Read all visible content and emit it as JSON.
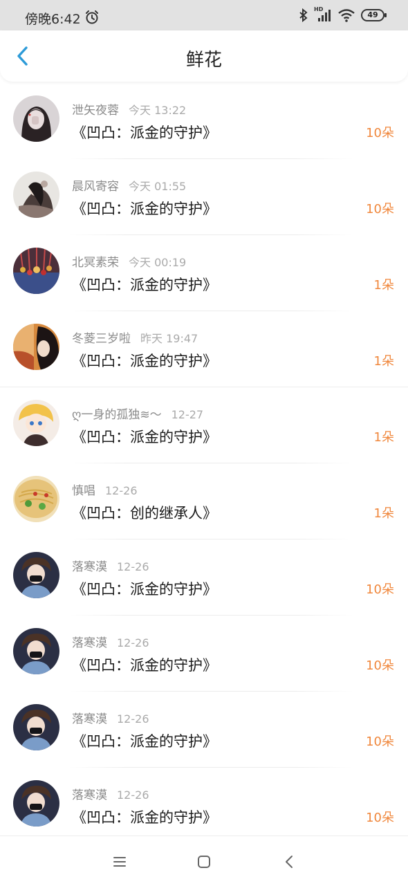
{
  "status": {
    "time": "傍晚6:42",
    "battery": "49",
    "hd": "HD"
  },
  "header": {
    "title": "鲜花"
  },
  "rows": [
    {
      "name": "泄矢夜蓉",
      "time": "今天 13:22",
      "book": "《凹凸：派金的守护》",
      "count": "10朵"
    },
    {
      "name": "晨风寄容",
      "time": "今天 01:55",
      "book": "《凹凸：派金的守护》",
      "count": "10朵"
    },
    {
      "name": "北冥素荣",
      "time": "今天 00:19",
      "book": "《凹凸：派金的守护》",
      "count": "1朵"
    },
    {
      "name": "冬菱三岁啦",
      "time": "昨天 19:47",
      "book": "《凹凸：派金的守护》",
      "count": "1朵"
    },
    {
      "name": "ღ一身的孤独≋〜",
      "time": "12-27",
      "book": "《凹凸：派金的守护》",
      "count": "1朵"
    },
    {
      "name": "慎唱",
      "time": "12-26",
      "book": "《凹凸：创的继承人》",
      "count": "1朵"
    },
    {
      "name": "落寒漠",
      "time": "12-26",
      "book": "《凹凸：派金的守护》",
      "count": "10朵"
    },
    {
      "name": "落寒漠",
      "time": "12-26",
      "book": "《凹凸：派金的守护》",
      "count": "10朵"
    },
    {
      "name": "落寒漠",
      "time": "12-26",
      "book": "《凹凸：派金的守护》",
      "count": "10朵"
    },
    {
      "name": "落寒漠",
      "time": "12-26",
      "book": "《凹凸：派金的守护》",
      "count": "10朵"
    }
  ],
  "colors": {
    "accent": "#2d9bd8",
    "count": "#f0873c",
    "name": "#8a8a8a"
  },
  "icons": [
    "alarm-icon",
    "bluetooth-icon",
    "signal-icon",
    "wifi-icon",
    "battery-icon",
    "back-arrow-icon",
    "menu-icon",
    "home-icon",
    "back-icon"
  ]
}
